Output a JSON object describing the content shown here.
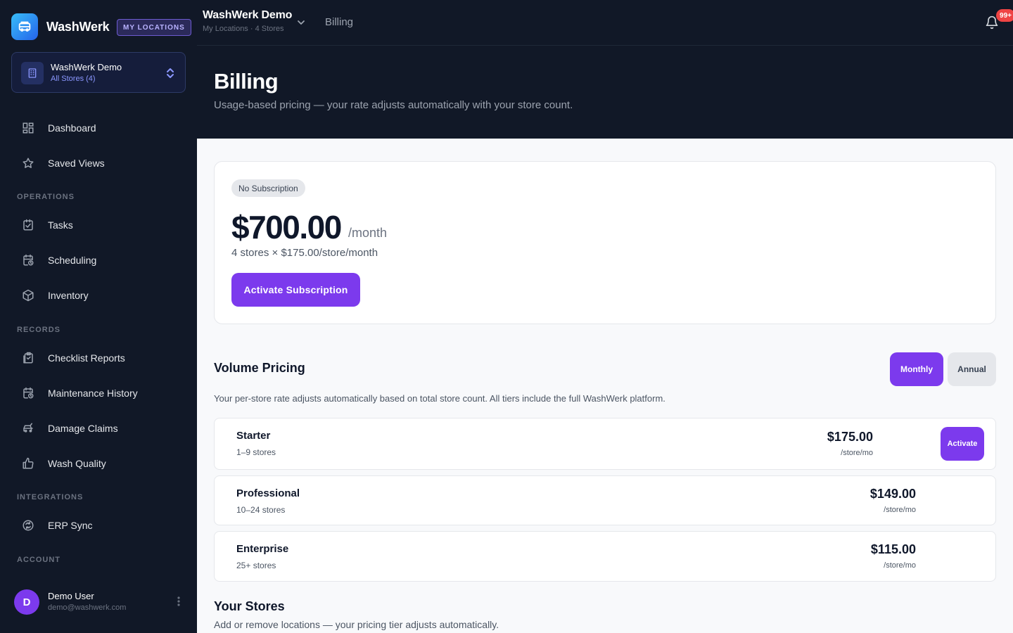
{
  "brand": {
    "name": "WashWerk",
    "badge": "MY LOCATIONS"
  },
  "store_switcher": {
    "name": "WashWerk Demo",
    "scope": "All Stores (4)"
  },
  "nav": {
    "main": [
      {
        "label": "Dashboard"
      },
      {
        "label": "Saved Views"
      }
    ],
    "operations_label": "OPERATIONS",
    "operations": [
      {
        "label": "Tasks"
      },
      {
        "label": "Scheduling"
      },
      {
        "label": "Inventory"
      }
    ],
    "records_label": "RECORDS",
    "records": [
      {
        "label": "Checklist Reports"
      },
      {
        "label": "Maintenance History"
      },
      {
        "label": "Damage Claims"
      },
      {
        "label": "Wash Quality"
      }
    ],
    "integrations_label": "INTEGRATIONS",
    "integrations": [
      {
        "label": "ERP Sync"
      }
    ],
    "account_label": "ACCOUNT"
  },
  "user": {
    "initial": "D",
    "name": "Demo User",
    "email": "demo@washwerk.com"
  },
  "topbar": {
    "title": "WashWerk Demo",
    "subtitle": "My Locations · 4 Stores",
    "crumb": "Billing",
    "notifications": "99+"
  },
  "page": {
    "title": "Billing",
    "subtitle": "Usage-based pricing — your rate adjusts automatically with your store count."
  },
  "subscription": {
    "status": "No Subscription",
    "amount": "$700.00",
    "period": "/month",
    "calc": "4 stores × $175.00/store/month",
    "cta": "Activate Subscription"
  },
  "volume": {
    "title": "Volume Pricing",
    "monthly": "Monthly",
    "annual": "Annual",
    "description": "Your per-store rate adjusts automatically based on total store count. All tiers include the full WashWerk platform.",
    "tiers": [
      {
        "name": "Starter",
        "range": "1–9 stores",
        "price": "$175.00",
        "unit": "/store/mo",
        "action": "Activate"
      },
      {
        "name": "Professional",
        "range": "10–24 stores",
        "price": "$149.00",
        "unit": "/store/mo"
      },
      {
        "name": "Enterprise",
        "range": "25+ stores",
        "price": "$115.00",
        "unit": "/store/mo"
      }
    ]
  },
  "stores": {
    "title": "Your Stores",
    "subtitle": "Add or remove locations — your pricing tier adjusts automatically."
  },
  "colors": {
    "accent": "#7c3aed",
    "sidebar": "#111827",
    "badge": "#ef4444"
  }
}
